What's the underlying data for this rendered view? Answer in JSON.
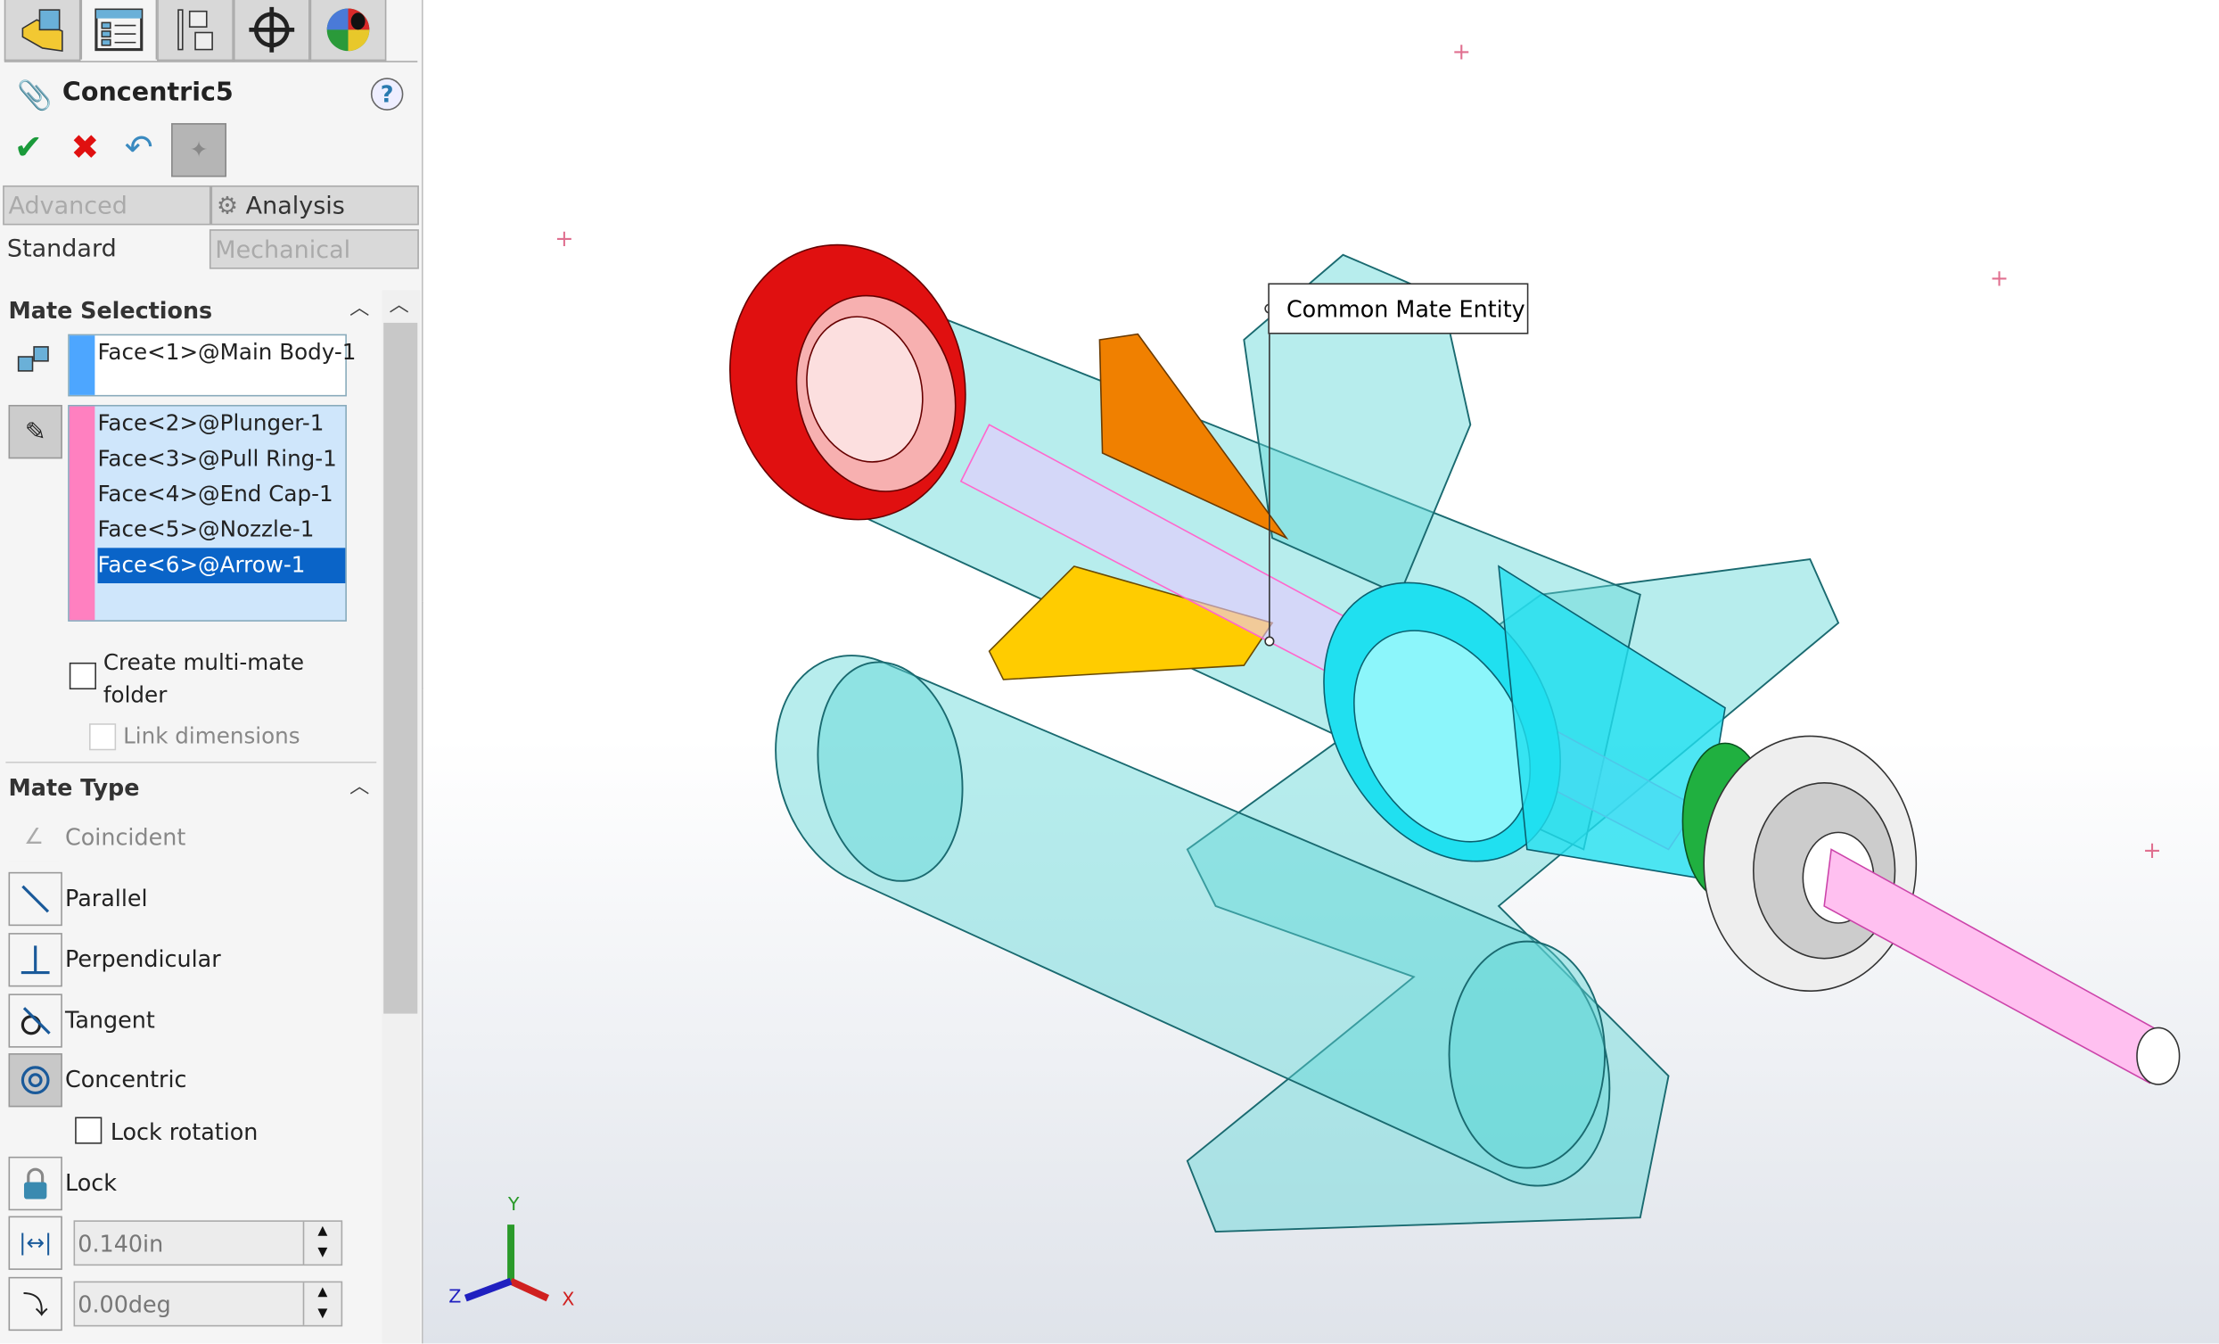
{
  "panel_tabs": [
    {
      "name": "featuremanager-icon"
    },
    {
      "name": "propertymanager-icon"
    },
    {
      "name": "configurationmanager-icon"
    },
    {
      "name": "dimxpert-icon"
    },
    {
      "name": "appearance-icon"
    }
  ],
  "title": "Concentric5",
  "help": "?",
  "actions": {
    "ok": "✔",
    "cancel": "✖",
    "undo": "↶",
    "pin": "📌"
  },
  "tabs": {
    "advanced": "Advanced",
    "analysis": "Analysis",
    "standard": "Standard",
    "mechanical": "Mechanical"
  },
  "mate_selections": {
    "header": "Mate Selections",
    "first": "Face<1>@Main Body-1",
    "first_color": "#4da6ff",
    "second": [
      "Face<2>@Plunger-1",
      "Face<3>@Pull Ring-1",
      "Face<4>@End Cap-1",
      "Face<5>@Nozzle-1",
      "Face<6>@Arrow-1"
    ],
    "second_color": "#ff80c0",
    "selected_index": 4,
    "multi_mate": "Create multi-mate folder",
    "link_dimensions": "Link dimensions"
  },
  "mate_type": {
    "header": "Mate Type",
    "items": [
      "Coincident",
      "Parallel",
      "Perpendicular",
      "Tangent",
      "Concentric"
    ],
    "active": "Concentric",
    "lock_rotation": "Lock rotation",
    "lock": "Lock",
    "distance": "0.140in",
    "angle": "0.00deg"
  },
  "viewport": {
    "tooltip": "Common Mate Entity",
    "axes": {
      "x": "X",
      "y": "Y",
      "z": "Z"
    }
  }
}
